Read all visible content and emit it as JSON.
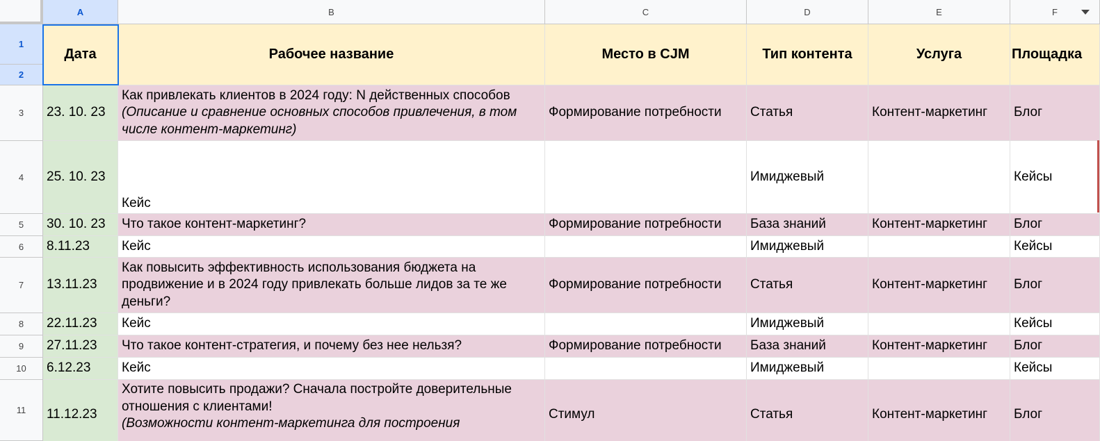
{
  "columns": [
    "A",
    "B",
    "C",
    "D",
    "E",
    "F"
  ],
  "row_numbers": [
    "1",
    "2",
    "3",
    "4",
    "5",
    "6",
    "7",
    "8",
    "9",
    "10",
    "11"
  ],
  "headers": {
    "date": "Дата",
    "title": "Рабочее название",
    "cjm": "Место в CJM",
    "type": "Тип контента",
    "service": "Услуга",
    "platform": "Площадка"
  },
  "rows": [
    {
      "date": "23. 10. 23",
      "title": "Как привлекать клиентов в 2024 году: N действенных способов",
      "title_note": "(Описание и сравнение основных способов привлечения, в том числе контент-маркетинг)",
      "cjm": "Формирование потребности",
      "type": "Статья",
      "service": "Контент-маркетинг",
      "platform": "Блог"
    },
    {
      "date": "25. 10. 23",
      "title": "Кейс",
      "cjm": "",
      "type": "Имиджевый",
      "service": "",
      "platform": "Кейсы"
    },
    {
      "date": "30. 10. 23",
      "title": "Что такое контент-маркетинг?",
      "cjm": "Формирование потребности",
      "type": "База знаний",
      "service": "Контент-маркетинг",
      "platform": "Блог"
    },
    {
      "date": "8.11.23",
      "title": "Кейс",
      "cjm": "",
      "type": "Имиджевый",
      "service": "",
      "platform": "Кейсы"
    },
    {
      "date": "13.11.23",
      "title": "Как повысить эффективность использования бюджета на продвижение и в 2024 году привлекать больше лидов за те же деньги?",
      "cjm": "Формирование потребности",
      "type": "Статья",
      "service": "Контент-маркетинг",
      "platform": "Блог"
    },
    {
      "date": "22.11.23",
      "title": "Кейс",
      "cjm": "",
      "type": "Имиджевый",
      "service": "",
      "platform": "Кейсы"
    },
    {
      "date": "27.11.23",
      "title": "Что такое контент-стратегия, и почему без нее нельзя?",
      "cjm": "Формирование потребности",
      "type": "База знаний",
      "service": "Контент-маркетинг",
      "platform": "Блог"
    },
    {
      "date": "6.12.23",
      "title": "Кейс",
      "cjm": "",
      "type": "Имиджевый",
      "service": "",
      "platform": "Кейсы"
    },
    {
      "date": "11.12.23",
      "title": "Хотите повысить продажи? Сначала постройте доверительные отношения с клиентами!",
      "title_note": "(Возможности контент-маркетинга для построения",
      "cjm": "Стимул",
      "type": "Статья",
      "service": "Контент-маркетинг",
      "platform": "Блог"
    }
  ],
  "colors": {
    "header_bg": "#fff2cc",
    "date_bg": "#d9ead3",
    "pink_row_bg": "#ead1dc",
    "selection": "#1a73e8"
  },
  "icons": {
    "filter": "chevron-down-icon"
  }
}
